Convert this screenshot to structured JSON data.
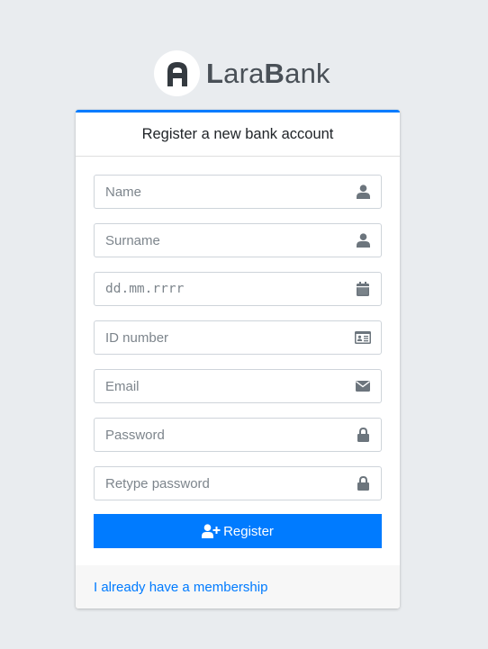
{
  "brand": {
    "name_first": "L",
    "name_mid": "ara",
    "name_bold": "B",
    "name_end": "ank"
  },
  "card": {
    "title": "Register a new bank account"
  },
  "form": {
    "fields": [
      {
        "placeholder": "Name",
        "icon": "user-icon"
      },
      {
        "placeholder": "Surname",
        "icon": "user-icon"
      },
      {
        "placeholder": "dd.mm.rrrr",
        "icon": "calendar-icon"
      },
      {
        "placeholder": "ID number",
        "icon": "id-card-icon"
      },
      {
        "placeholder": "Email",
        "icon": "envelope-icon"
      },
      {
        "placeholder": "Password",
        "icon": "lock-icon"
      },
      {
        "placeholder": "Retype password",
        "icon": "lock-icon"
      }
    ],
    "submit_label": "Register",
    "submit_icon": "user-plus-icon"
  },
  "footer": {
    "login_link": "I already have a membership"
  },
  "colors": {
    "accent": "#007bff",
    "background": "#e9ecef",
    "icon": "#6c757d"
  }
}
